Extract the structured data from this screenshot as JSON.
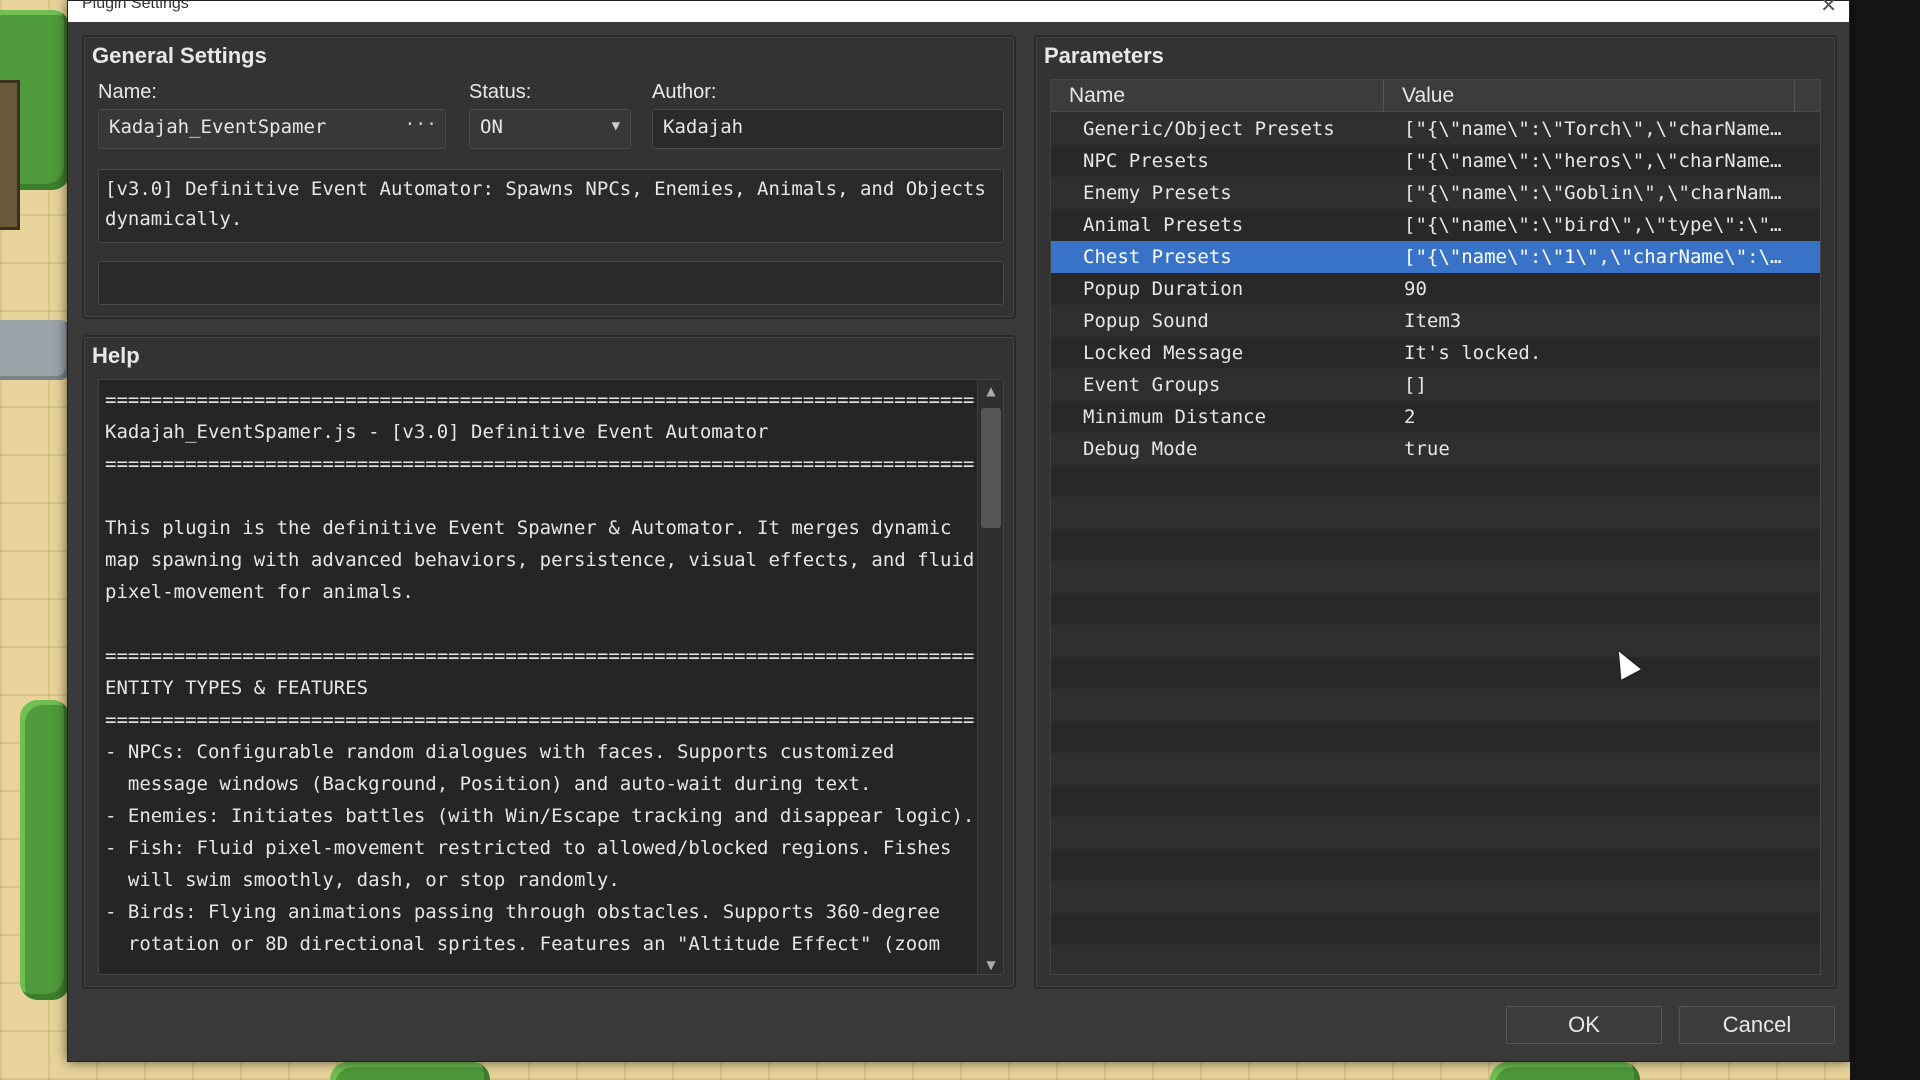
{
  "window": {
    "title": "Plugin Settings",
    "close_glyph": "✕"
  },
  "general": {
    "title": "General Settings",
    "name_label": "Name:",
    "name_value": "Kadajah_EventSpamer",
    "name_button": "···",
    "status_label": "Status:",
    "status_value": "ON",
    "author_label": "Author:",
    "author_value": "Kadajah",
    "description": "[v3.0] Definitive Event Automator: Spawns NPCs, Enemies, Animals, and Objects\ndynamically.",
    "extra_field": ""
  },
  "help": {
    "title": "Help",
    "text": "==============================================================================\nKadajah_EventSpamer.js - [v3.0] Definitive Event Automator\n==============================================================================\n\nThis plugin is the definitive Event Spawner & Automator. It merges dynamic\nmap spawning with advanced behaviors, persistence, visual effects, and fluid\npixel-movement for animals.\n\n==============================================================================\nENTITY TYPES & FEATURES\n==============================================================================\n- NPCs: Configurable random dialogues with faces. Supports customized\n  message windows (Background, Position) and auto-wait during text.\n- Enemies: Initiates battles (with Win/Escape tracking and disappear logic).\n- Fish: Fluid pixel-movement restricted to allowed/blocked regions. Fishes\n  will swim smoothly, dash, or stop randomly.\n- Birds: Flying animations passing through obstacles. Supports 360-degree\n  rotation or 8D directional sprites. Features an \"Altitude Effect\" (zoom"
  },
  "parameters": {
    "title": "Parameters",
    "columns": {
      "name": "Name",
      "value": "Value"
    },
    "rows": [
      {
        "name": "Generic/Object Presets",
        "value": "[\"{\\\"name\\\":\\\"Torch\\\",\\\"charName···"
      },
      {
        "name": "NPC Presets",
        "value": "[\"{\\\"name\\\":\\\"heros\\\",\\\"charName···"
      },
      {
        "name": "Enemy Presets",
        "value": "[\"{\\\"name\\\":\\\"Goblin\\\",\\\"charNam···"
      },
      {
        "name": "Animal Presets",
        "value": "[\"{\\\"name\\\":\\\"bird\\\",\\\"type\\\":\\\"···"
      },
      {
        "name": "Chest Presets",
        "value": "[\"{\\\"name\\\":\\\"1\\\",\\\"charName\\\":\\···",
        "selected": true
      },
      {
        "name": "Popup Duration",
        "value": "90"
      },
      {
        "name": "Popup Sound",
        "value": "Item3"
      },
      {
        "name": "Locked Message",
        "value": "It's locked."
      },
      {
        "name": "Event Groups",
        "value": "[]"
      },
      {
        "name": "Minimum Distance",
        "value": "2"
      },
      {
        "name": "Debug Mode",
        "value": "true"
      }
    ]
  },
  "buttons": {
    "ok": "OK",
    "cancel": "Cancel"
  },
  "colors": {
    "selection": "#3873c8",
    "dialog_bg": "#3a3a3a"
  },
  "icons": {
    "dropdown": "chevron-down-icon",
    "scroll_up": "arrow-up-icon",
    "scroll_down": "arrow-down-icon"
  }
}
